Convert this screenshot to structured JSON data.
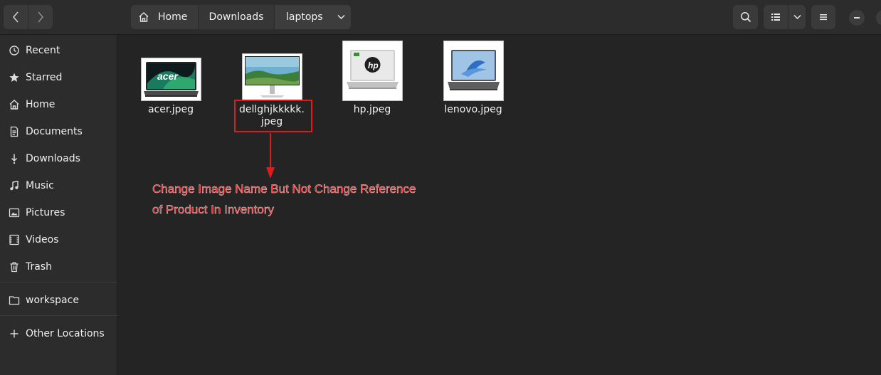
{
  "header": {
    "breadcrumbs": [
      "Home",
      "Downloads",
      "laptops"
    ]
  },
  "sidebar": {
    "items": [
      {
        "label": "Recent",
        "icon": "clock-icon"
      },
      {
        "label": "Starred",
        "icon": "star-icon"
      },
      {
        "label": "Home",
        "icon": "home-icon"
      },
      {
        "label": "Documents",
        "icon": "document-icon"
      },
      {
        "label": "Downloads",
        "icon": "download-icon"
      },
      {
        "label": "Music",
        "icon": "music-icon"
      },
      {
        "label": "Pictures",
        "icon": "picture-icon"
      },
      {
        "label": "Videos",
        "icon": "video-icon"
      },
      {
        "label": "Trash",
        "icon": "trash-icon"
      }
    ],
    "bookmarks": [
      {
        "label": "workspace",
        "icon": "folder-icon"
      }
    ],
    "other_locations": {
      "label": "Other Locations",
      "icon": "plus-icon"
    }
  },
  "files": [
    {
      "name": "acer.jpeg"
    },
    {
      "name_line1": "dellghjkkkkk.",
      "name_line2": "jpeg"
    },
    {
      "name": "hp.jpeg"
    },
    {
      "name": "lenovo.jpeg"
    }
  ],
  "annotation": {
    "line1": "Change Image Name But Not Change Reference",
    "line2": "of Product In Inventory",
    "color": "#e8272a"
  },
  "colors": {
    "window_bg": "#242424",
    "sidebar_bg": "#2c2c2c",
    "button_bg": "#3a3a3a",
    "highlight": "#e11b1b"
  }
}
